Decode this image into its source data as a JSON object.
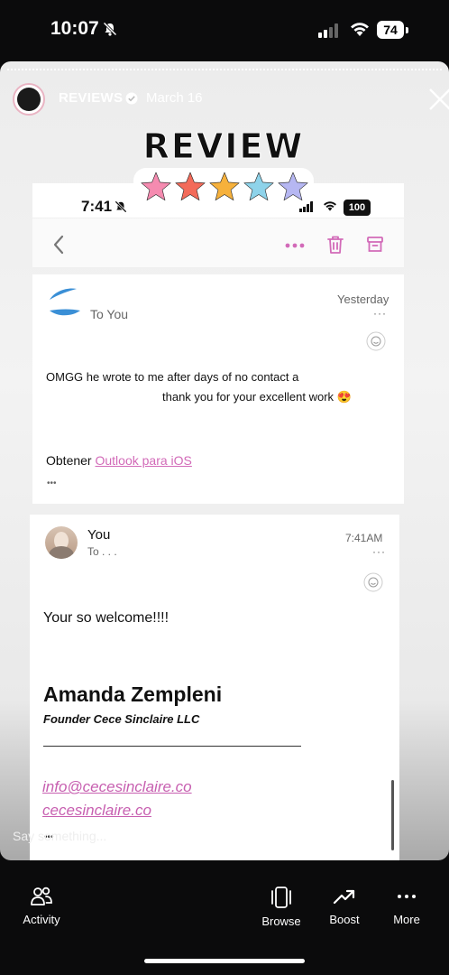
{
  "status_bar": {
    "time": "10:07",
    "battery": "74"
  },
  "story": {
    "user": "REVIEWS",
    "date": "March 16",
    "sticker_title": "REVIEW",
    "stars": [
      "#f58bb0",
      "#f36b5a",
      "#f6b13c",
      "#8ed3ea",
      "#b6b7f2"
    ],
    "reply_placeholder": "Say something..."
  },
  "screenshot": {
    "status_time": "7:41",
    "status_battery": "100",
    "message1": {
      "to": "To You",
      "date": "Yesterday",
      "body_line1": "OMGG he wrote to me after days of no contact a",
      "body_line2": "thank you for your excellent work 😍",
      "footer_prefix": "Obtener ",
      "footer_link": "Outlook para iOS",
      "more": "•••"
    },
    "message2": {
      "sender": "You",
      "to": "To . . .",
      "time": "7:41AM",
      "body": "Your so welcome!!!!",
      "sig_name": "Amanda Zempleni",
      "sig_title": "Founder Cece Sinclaire LLC",
      "email": "info@cecesinclaire.co",
      "website": "cecesinclaire.co",
      "more": "•••"
    }
  },
  "bottom_nav": {
    "activity": "Activity",
    "browse": "Browse",
    "boost": "Boost",
    "more": "More"
  },
  "colors": {
    "accent_pink": "#d26ab8",
    "outlook_blue": "#3a8fd6"
  }
}
